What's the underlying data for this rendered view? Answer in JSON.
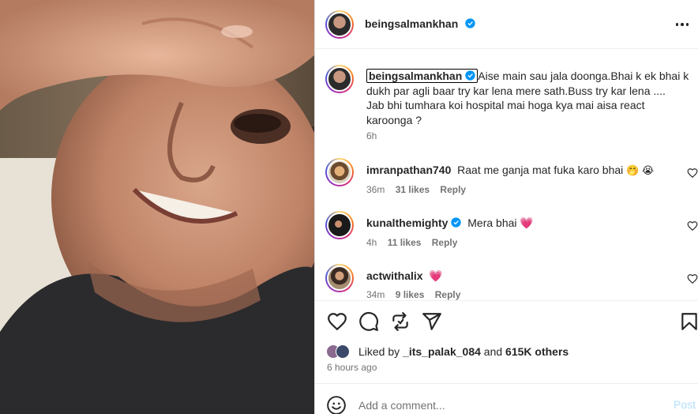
{
  "post": {
    "username": "beingsalmankhan",
    "more_icon": "more-options-icon"
  },
  "caption": {
    "username": "beingsalmankhan",
    "text": "Aise main sau jala doonga.Bhai k ek bhai k dukh par agli baar try kar lena mere sath.Buss try kar lena ....",
    "text2": "Jab bhi tumhara koi hospital mai hoga kya mai aisa react karoonga ?",
    "time": "6h"
  },
  "comments": [
    {
      "username": "imranpathan740",
      "text": "Raat me ganja mat fuka karo bhai",
      "time": "36m",
      "likes": "31 likes",
      "reply": "Reply",
      "emojis": "🤭 😭"
    },
    {
      "username": "kunalthemighty",
      "verified": true,
      "text": "Mera bhai",
      "time": "4h",
      "likes": "11 likes",
      "reply": "Reply",
      "emojis": "💗"
    },
    {
      "username": "actwithalix",
      "text": "",
      "time": "34m",
      "likes": "9 likes",
      "reply": "Reply",
      "emojis": "💗"
    }
  ],
  "actions": {
    "like_icon": "heart-icon",
    "comment_icon": "comment-icon",
    "share_icon": "repost-icon",
    "send_icon": "send-icon",
    "save_icon": "bookmark-icon"
  },
  "likes": {
    "prefix": "Liked by",
    "first_liker": "_its_palak_084",
    "and": "and",
    "others": "615K others"
  },
  "timestamp": "6 hours ago",
  "add_comment": {
    "placeholder": "Add a comment...",
    "post_label": "Post"
  },
  "colors": {
    "verified": "#0095f6",
    "post_disabled": "#b2dffc",
    "heart_emoji": "#f03e5f",
    "meta": "#737373"
  }
}
